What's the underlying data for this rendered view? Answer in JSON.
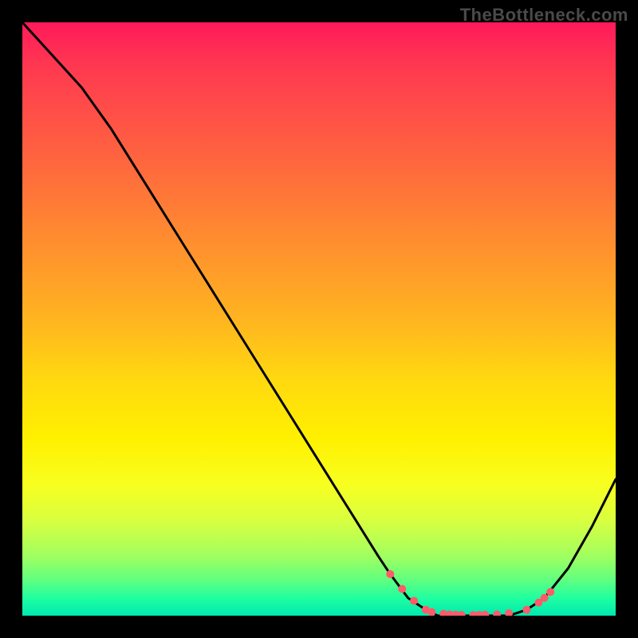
{
  "watermark": "TheBottleneck.com",
  "chart_data": {
    "type": "line",
    "title": "",
    "xlabel": "",
    "ylabel": "",
    "xlim": [
      0,
      100
    ],
    "ylim": [
      0,
      100
    ],
    "series": [
      {
        "name": "curve",
        "x": [
          0,
          10,
          15,
          20,
          25,
          30,
          35,
          40,
          45,
          50,
          55,
          60,
          62,
          65,
          68,
          70,
          73,
          76,
          79,
          82,
          85,
          88,
          92,
          96,
          100
        ],
        "y": [
          100,
          89,
          82,
          74,
          66,
          58,
          50,
          42,
          34,
          26,
          18,
          10,
          7,
          3,
          1,
          0,
          0,
          0,
          0,
          0,
          1,
          3,
          8,
          15,
          23
        ]
      }
    ],
    "markers": {
      "name": "dots",
      "x": [
        62,
        64,
        66,
        68,
        69,
        71,
        72,
        73,
        74,
        76,
        77,
        78,
        80,
        82,
        85,
        87,
        88,
        89
      ],
      "y": [
        7,
        4.5,
        2.5,
        1,
        0.6,
        0.3,
        0.2,
        0.15,
        0.12,
        0.1,
        0.12,
        0.15,
        0.2,
        0.4,
        1,
        2.2,
        3,
        4
      ]
    },
    "colors": {
      "line": "#000000",
      "markers": "#ff5a6a"
    }
  }
}
